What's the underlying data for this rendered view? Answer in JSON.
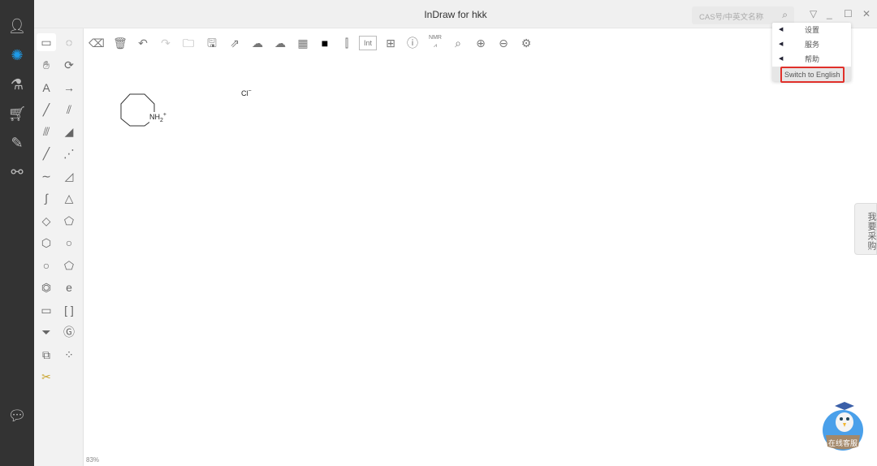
{
  "window": {
    "title": "InDraw for hkk",
    "zoom_level": "83%"
  },
  "search": {
    "placeholder": "CAS号/中英文名称"
  },
  "menu": {
    "items": [
      {
        "label": "设置"
      },
      {
        "label": "服务"
      },
      {
        "label": "帮助"
      }
    ],
    "switch_language": "Switch to English"
  },
  "side_buttons": {
    "buy": "我要采购",
    "customer_service": "在线客服"
  },
  "canvas": {
    "atom_label": "NH",
    "atom_sub": "2",
    "atom_charge": "+",
    "counter_ion": "Cl",
    "counter_charge": "−"
  },
  "sidebar": [
    "user-icon",
    "structure-icon",
    "microscope-icon",
    "cart-icon",
    "notes-icon",
    "share-icon"
  ],
  "colors": {
    "sidebar": "#333333",
    "accent": "#1e9be8",
    "highlight": "#e0302a"
  }
}
